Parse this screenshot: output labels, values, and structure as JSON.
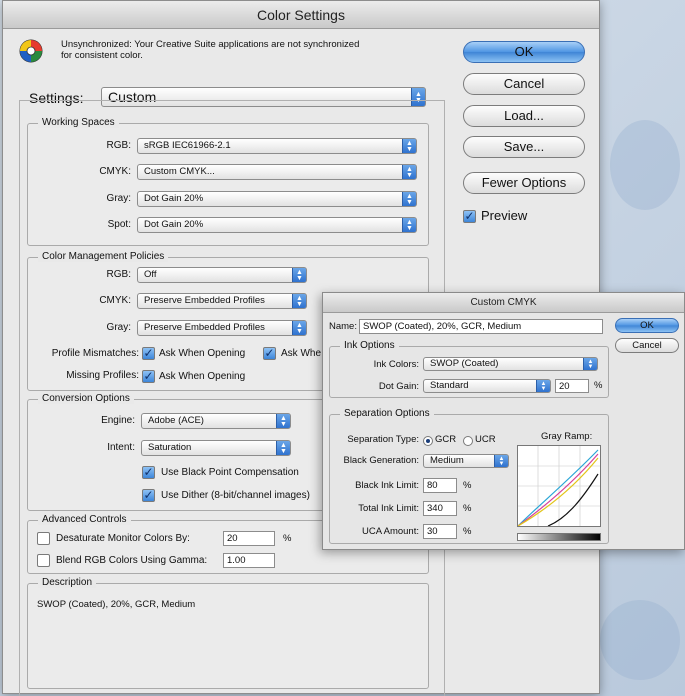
{
  "main_dialog": {
    "title": "Color Settings",
    "sync_message": "Unsynchronized: Your Creative Suite applications are not synchronized for consistent color.",
    "settings": {
      "label": "Settings:",
      "value": "Custom"
    },
    "buttons": {
      "ok": "OK",
      "cancel": "Cancel",
      "load": "Load...",
      "save": "Save...",
      "fewer_options": "Fewer Options",
      "preview": "Preview"
    },
    "working_spaces": {
      "title": "Working Spaces",
      "rgb": {
        "label": "RGB:",
        "value": "sRGB IEC61966-2.1"
      },
      "cmyk": {
        "label": "CMYK:",
        "value": "Custom CMYK..."
      },
      "gray": {
        "label": "Gray:",
        "value": "Dot Gain 20%"
      },
      "spot": {
        "label": "Spot:",
        "value": "Dot Gain 20%"
      }
    },
    "policies": {
      "title": "Color Management Policies",
      "rgb": {
        "label": "RGB:",
        "value": "Off"
      },
      "cmyk": {
        "label": "CMYK:",
        "value": "Preserve Embedded Profiles"
      },
      "gray": {
        "label": "Gray:",
        "value": "Preserve Embedded Profiles"
      },
      "profile_mismatches": {
        "label": "Profile Mismatches:",
        "opt1": "Ask When Opening",
        "opt2": "Ask Whe"
      },
      "missing_profiles": {
        "label": "Missing Profiles:",
        "opt1": "Ask When Opening"
      }
    },
    "conversion": {
      "title": "Conversion Options",
      "engine": {
        "label": "Engine:",
        "value": "Adobe (ACE)"
      },
      "intent": {
        "label": "Intent:",
        "value": "Saturation"
      },
      "black_point": "Use Black Point Compensation",
      "dither": "Use Dither (8-bit/channel images)"
    },
    "advanced": {
      "title": "Advanced Controls",
      "desaturate": {
        "label": "Desaturate Monitor Colors By:",
        "value": "20",
        "unit": "%"
      },
      "blend": {
        "label": "Blend RGB Colors Using Gamma:",
        "value": "1.00"
      }
    },
    "description": {
      "title": "Description",
      "text": "SWOP (Coated), 20%, GCR, Medium"
    }
  },
  "custom_cmyk": {
    "title": "Custom CMYK",
    "name": {
      "label": "Name:",
      "value": "SWOP (Coated), 20%, GCR, Medium"
    },
    "buttons": {
      "ok": "OK",
      "cancel": "Cancel"
    },
    "ink_options": {
      "title": "Ink Options",
      "ink_colors": {
        "label": "Ink Colors:",
        "value": "SWOP (Coated)"
      },
      "dot_gain": {
        "label": "Dot Gain:",
        "value": "Standard",
        "amount": "20",
        "unit": "%"
      }
    },
    "separation": {
      "title": "Separation Options",
      "type_label": "Separation Type:",
      "gcr": "GCR",
      "ucr": "UCR",
      "black_gen": {
        "label": "Black Generation:",
        "value": "Medium"
      },
      "black_ink_limit": {
        "label": "Black Ink Limit:",
        "value": "80",
        "unit": "%"
      },
      "total_ink_limit": {
        "label": "Total Ink Limit:",
        "value": "340",
        "unit": "%"
      },
      "uca_amount": {
        "label": "UCA Amount:",
        "value": "30",
        "unit": "%"
      },
      "gray_ramp_label": "Gray Ramp:"
    }
  },
  "colors": {
    "accent": "#3f85d6",
    "dialog_bg": "#e9e9e9"
  },
  "icons": [
    "color-wheel-icon",
    "popup-arrow-icon",
    "checkmark-icon"
  ]
}
